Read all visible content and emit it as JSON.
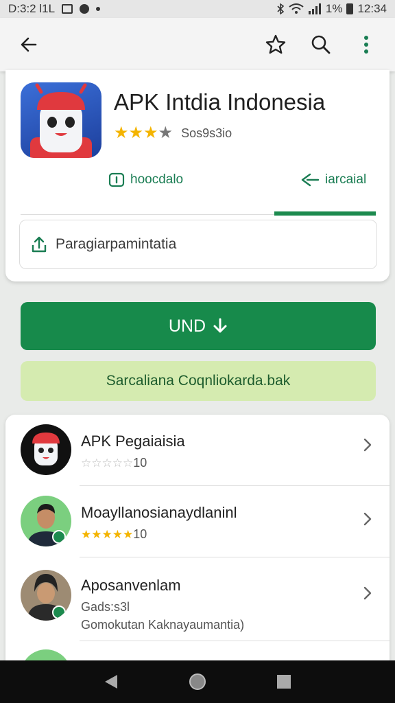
{
  "status_bar": {
    "time_left": "D:3:2 l1L",
    "battery": "1%",
    "time_right": "12:34"
  },
  "app": {
    "title": "APK Intdia Indonesia",
    "rating_stars": 3,
    "rating_text": "Sos9s3io"
  },
  "tabs": {
    "left_label": "hoocdalo",
    "right_label": "iarcaial"
  },
  "share": {
    "label": "Paragiarpamintatia"
  },
  "install_button": {
    "label": "UND"
  },
  "promo_button": {
    "label": "Sarcaliana Coqnliokarda.bak"
  },
  "list": [
    {
      "title": "APK Pegaiaisia",
      "stars": 0,
      "count": "10",
      "icon": "robot-avatar"
    },
    {
      "title": "Moayllanosianaydlaninl",
      "stars": 5,
      "count": "10",
      "icon": "man-avatar"
    },
    {
      "title": "Aposanvenlam",
      "sub1": "Gads:s3l",
      "sub2": "Gomokutan Kaknayaumantia)",
      "icon": "woman-avatar"
    }
  ],
  "colors": {
    "accent": "#178a4b",
    "promo_bg": "#d5ebb0",
    "star": "#f4b400"
  }
}
